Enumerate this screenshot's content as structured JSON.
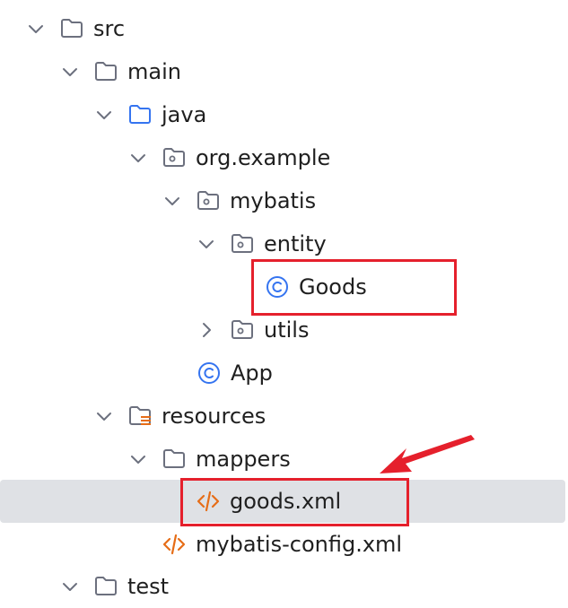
{
  "tree": {
    "items": [
      {
        "label": "src",
        "expanded": true,
        "icon": "folder-icon"
      },
      {
        "label": "main",
        "expanded": true,
        "icon": "folder-icon"
      },
      {
        "label": "java",
        "expanded": true,
        "icon": "source-folder-icon"
      },
      {
        "label": "org.example",
        "expanded": true,
        "icon": "package-icon"
      },
      {
        "label": "mybatis",
        "expanded": true,
        "icon": "package-icon"
      },
      {
        "label": "entity",
        "expanded": true,
        "icon": "package-icon"
      },
      {
        "label": "Goods",
        "icon": "class-icon"
      },
      {
        "label": "utils",
        "expanded": false,
        "icon": "package-icon"
      },
      {
        "label": "App",
        "icon": "class-icon"
      },
      {
        "label": "resources",
        "expanded": true,
        "icon": "resources-folder-icon"
      },
      {
        "label": "mappers",
        "expanded": true,
        "icon": "folder-icon"
      },
      {
        "label": "goods.xml",
        "icon": "xml-file-icon",
        "selected": true
      },
      {
        "label": "mybatis-config.xml",
        "icon": "xml-file-icon"
      },
      {
        "label": "test",
        "expanded": true,
        "icon": "folder-icon"
      }
    ]
  },
  "colors": {
    "selection": "#dfe1e5",
    "annotation": "#e5202c",
    "class_icon": "#3574f0",
    "xml_icon": "#e66d17",
    "folder_stroke": "#6c707e",
    "source_folder_stroke": "#3574f0"
  }
}
